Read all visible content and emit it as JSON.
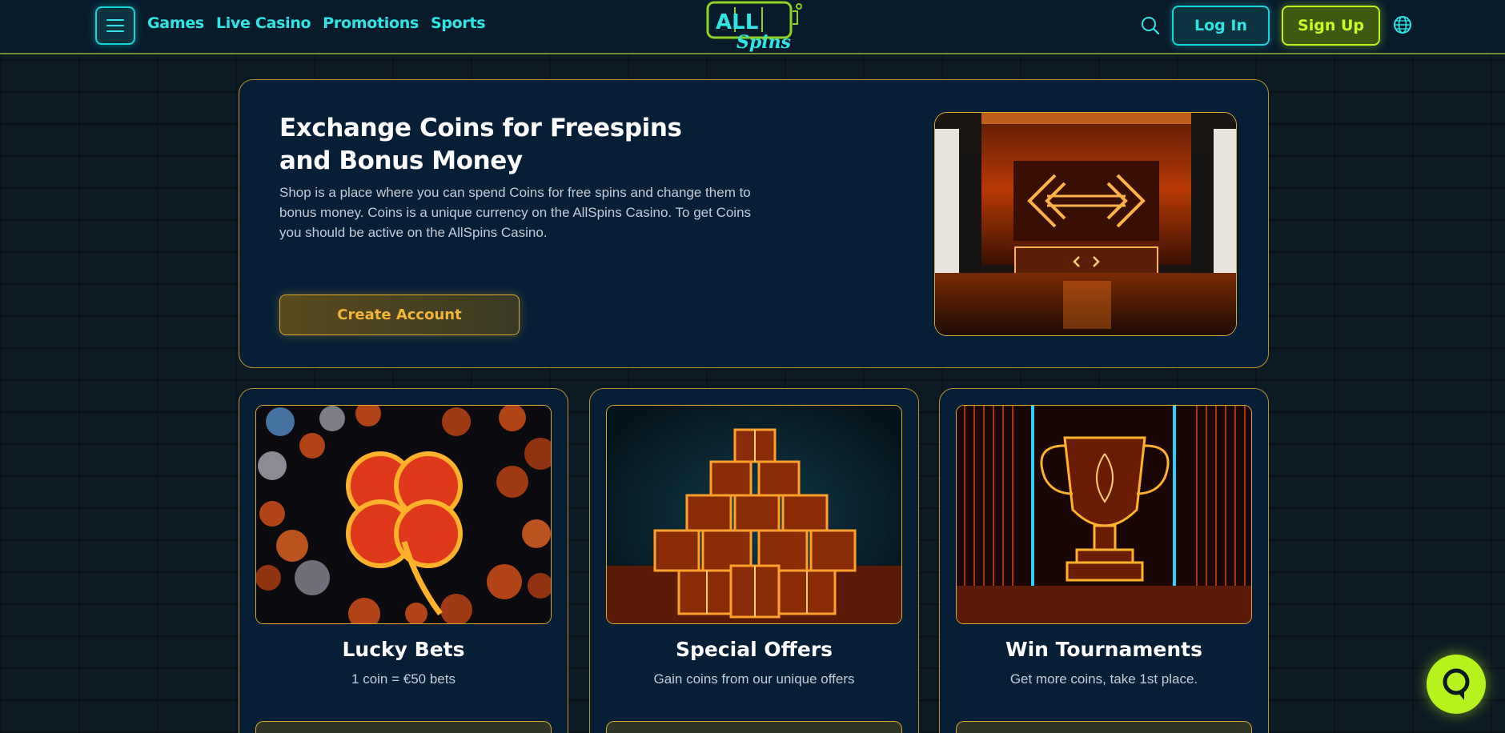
{
  "header": {
    "nav": [
      "Games",
      "Live Casino",
      "Promotions",
      "Sports"
    ],
    "logo_top": "ALL",
    "logo_bottom": "Spins",
    "login_label": "Log In",
    "signup_label": "Sign Up"
  },
  "hero": {
    "title": "Exchange Coins for Freespins and Bonus Money",
    "description": "Shop is a place where you can spend Coins for free spins and change them to bonus money. Coins is a unique currency on the AllSpins Casino. To get Coins you should be active on the AllSpins Casino.",
    "cta_label": "Create Account"
  },
  "cards": [
    {
      "title": "Lucky Bets",
      "subtitle": "1 coin = €50 bets"
    },
    {
      "title": "Special Offers",
      "subtitle": "Gain coins from our unique offers"
    },
    {
      "title": "Win Tournaments",
      "subtitle": "Get more coins, take 1st place."
    }
  ],
  "colors": {
    "accent_cyan": "#15d4d9",
    "accent_lime": "#b6f21e",
    "accent_gold": "#d9a92e",
    "panel_bg": "#061f37"
  },
  "icons": [
    "menu-icon",
    "search-icon",
    "globe-icon",
    "chat-icon"
  ]
}
